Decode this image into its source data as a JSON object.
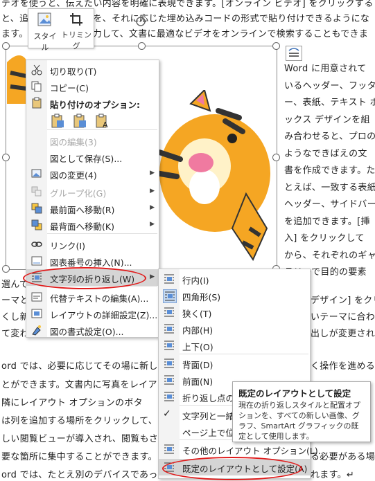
{
  "document": {
    "top_lines": [
      "デオを使うと、伝えたい内容を明確に表現できます。[オンライン ビデオ] をクリックする",
      "と、追加したいビデオを、それに応じた埋め込みコードの形式で貼り付けできるようにな",
      "ます。キーワードを入力して、文書に最適なビデオをオンラインで検索することもできま"
    ],
    "right_lines": [
      "Word に用意されて",
      "いるヘッダー、フッタ",
      "ー、表紙、テキスト ボ",
      "ックス デザインを組",
      "み合わせると、プロの",
      "ようなできばえの文",
      "書を作成できます。た",
      "とえば、一致する表紙",
      "ヘッダー、サイドバー",
      "を追加できます。[挿",
      "入] をクリックして",
      "から、それぞれのギャ",
      "ラリーで目的の要素"
    ],
    "left_lines": [
      "選んで",
      "ーマと",
      "くし新",
      "て変わ",
      "ord では、必要に応じてその場に新し",
      "とができます。文書内に写真をレイア",
      "隣にレイアウト オプションのボタ",
      "は列を追加する場所をクリックして、",
      "しい閲覧ビューが導入され、閲覧もさ",
      "要な箇所に集中することができます。",
      "ord では、たとえ別のデバイスであっ"
    ],
    "right_lower_lines": [
      "デザイン] をクリ",
      "いテーマに合わ",
      "出しが変更され",
      "く操作を進める"
    ],
    "bottom_right_tail": [
      "る必要がある場合",
      "れます。↵"
    ]
  },
  "mini_toolbar": {
    "style_label": "スタイル",
    "trim_label": "トリミング"
  },
  "context_menu": {
    "items": [
      {
        "label": "切り取り(T)",
        "icon": "scissors-icon",
        "disabled": false
      },
      {
        "label": "コピー(C)",
        "icon": "copy-icon",
        "disabled": false
      },
      {
        "label": "貼り付けのオプション:",
        "icon": "paste-icon",
        "disabled": false,
        "bold": true
      },
      {
        "label": "図の編集(3)",
        "icon": "",
        "disabled": true
      },
      {
        "label": "図として保存(S)...",
        "icon": "",
        "disabled": false
      },
      {
        "label": "図の変更(4)",
        "icon": "change-picture-icon",
        "disabled": false,
        "submenu": true
      },
      {
        "label": "グループ化(G)",
        "icon": "group-icon",
        "disabled": true,
        "submenu": true
      },
      {
        "label": "最前面へ移動(R)",
        "icon": "bring-front-icon",
        "disabled": false,
        "submenu": true
      },
      {
        "label": "最背面へ移動(K)",
        "icon": "send-back-icon",
        "disabled": false,
        "submenu": true
      },
      {
        "label": "リンク(I)",
        "icon": "link-icon",
        "disabled": false
      },
      {
        "label": "図表番号の挿入(N)...",
        "icon": "caption-icon",
        "disabled": false
      },
      {
        "label": "文字列の折り返し(W)",
        "icon": "wrap-icon",
        "disabled": false,
        "submenu": true,
        "highlighted": true
      },
      {
        "label": "代替テキストの編集(A)...",
        "icon": "alt-text-icon",
        "disabled": false
      },
      {
        "label": "レイアウトの詳細設定(Z)...",
        "icon": "layout-icon",
        "disabled": false
      },
      {
        "label": "図の書式設定(O)...",
        "icon": "format-icon",
        "disabled": false
      }
    ]
  },
  "wrap_submenu": {
    "items": [
      {
        "label": "行内(I)"
      },
      {
        "label": "四角形(S)",
        "checked": true
      },
      {
        "label": "狭く(T)"
      },
      {
        "label": "内部(H)"
      },
      {
        "label": "上下(O)"
      },
      {
        "label": "背面(D)"
      },
      {
        "label": "前面(N)"
      },
      {
        "label": "折り返し点の編"
      },
      {
        "label": "文字列と一緒"
      },
      {
        "label": "ページ上で位置"
      },
      {
        "label": "その他のレイアウト オプション(L)..."
      },
      {
        "label": "既定のレイアウトとして設定(A)",
        "highlighted": true
      }
    ]
  },
  "tooltip": {
    "title": "既定のレイアウトとして設定",
    "body": "現在の折り返しスタイルと配置オプションを、すべての新しい画像、グラフ、SmartArt グラフィックの既定として使用します。"
  },
  "colors": {
    "accent_red": "#e01b1b",
    "menu_highlight": "#d5d5d5",
    "tiger_orange": "#f5a623"
  }
}
